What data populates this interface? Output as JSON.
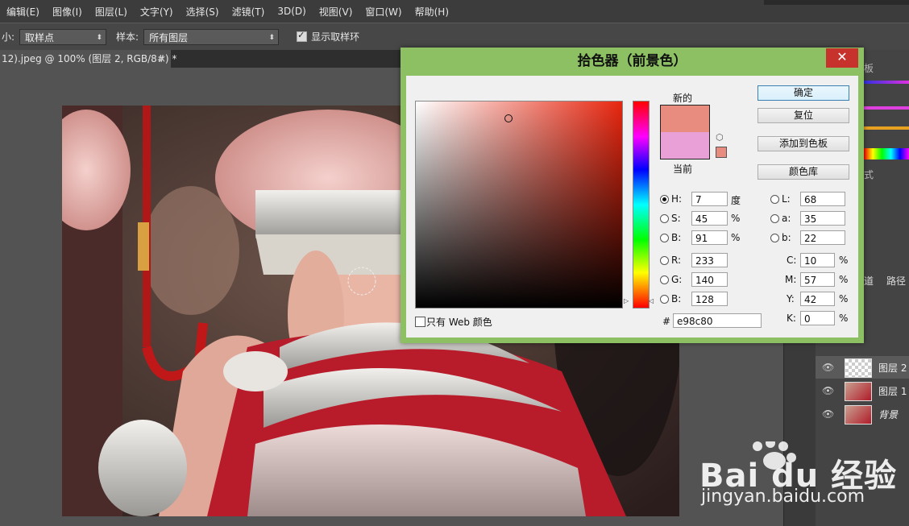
{
  "menu": [
    "编辑(E)",
    "图像(I)",
    "图层(L)",
    "文字(Y)",
    "选择(S)",
    "滤镜(T)",
    "3D(D)",
    "视图(V)",
    "窗口(W)",
    "帮助(H)"
  ],
  "options": {
    "size_label": "小:",
    "size_value": "取样点",
    "sample_label": "样本:",
    "sample_value": "所有图层",
    "show_ring_label": "显示取样环"
  },
  "doc_tab": {
    "title": "12).jpeg @ 100% (图层 2, RGB/8#) *",
    "close": "×"
  },
  "dialog": {
    "title": "拾色器（前景色）",
    "close": "✕",
    "new_label": "新的",
    "current_label": "当前",
    "new_color": "#e98c80",
    "current_color": "#e8a0d6",
    "buttons": {
      "ok": "确定",
      "reset": "复位",
      "add_swatch": "添加到色板",
      "library": "颜色库"
    },
    "hsb": {
      "h_label": "H:",
      "h": "7",
      "h_unit": "度",
      "s_label": "S:",
      "s": "45",
      "s_unit": "%",
      "b_label": "B:",
      "b": "91",
      "b_unit": "%"
    },
    "rgb": {
      "r_label": "R:",
      "r": "233",
      "g_label": "G:",
      "g": "140",
      "b_label": "B:",
      "b": "128"
    },
    "lab": {
      "l_label": "L:",
      "l": "68",
      "a_label": "a:",
      "a": "35",
      "b_label": "b:",
      "b": "22"
    },
    "cmyk": {
      "c_label": "C:",
      "c": "10",
      "m_label": "M:",
      "m": "57",
      "y_label": "Y:",
      "y": "42",
      "k_label": "K:",
      "k": "0",
      "unit": "%"
    },
    "hex_label": "#",
    "hex": "e98c80",
    "web_only_label": "只有 Web 颜色"
  },
  "panel_tabs": {
    "channels": "道",
    "paths": "路径",
    "styles": "式",
    "swatches": "板"
  },
  "layers": [
    {
      "name": "图层 2"
    },
    {
      "name": "图层 1"
    },
    {
      "name": "背景"
    }
  ],
  "watermark": {
    "logo": "Bai du 经验",
    "url": "jingyan.baidu.com"
  }
}
